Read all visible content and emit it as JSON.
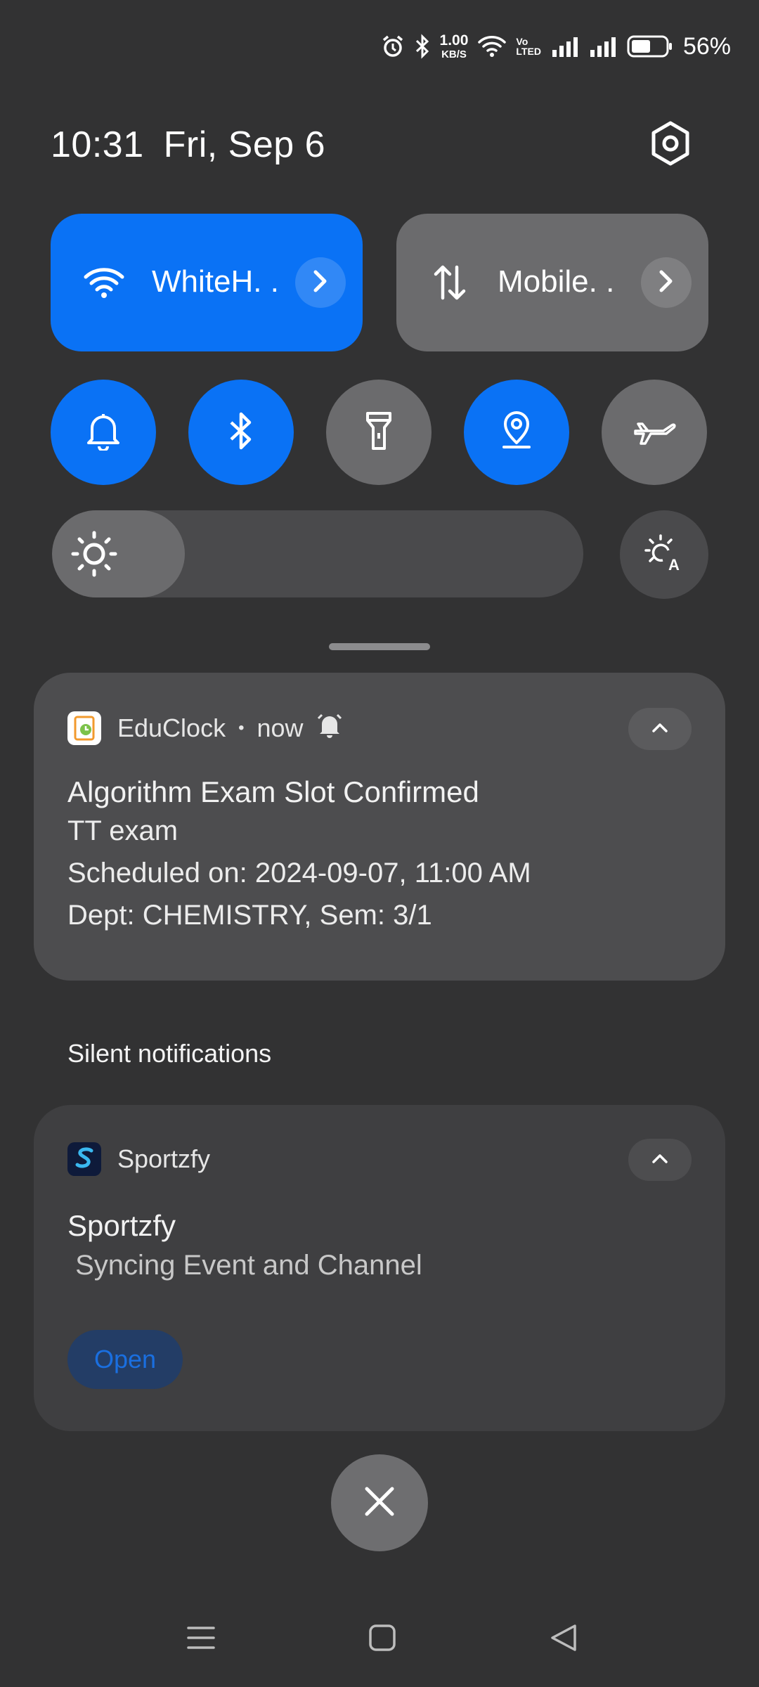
{
  "status_bar": {
    "net_speed_value": "1.00",
    "net_speed_unit": "KB/S",
    "volte_top": "Vo",
    "volte_bottom": "LTED",
    "battery_percent": "56%",
    "battery_level": 0.56,
    "icons": [
      "alarm-icon",
      "bluetooth-icon",
      "wifi-icon",
      "signal-icon",
      "signal-icon",
      "battery-icon"
    ]
  },
  "header": {
    "time": "10:31",
    "date": "Fri, Sep 6",
    "settings_icon": "settings-icon"
  },
  "quick_settings": {
    "wifi_tile": {
      "label": "WhiteH. .",
      "state": "on"
    },
    "mobile_tile": {
      "label": "Mobile. .",
      "state": "off"
    },
    "toggles": [
      {
        "name": "sound",
        "icon": "bell-icon",
        "state": "on"
      },
      {
        "name": "bluetooth",
        "icon": "bluetooth-icon",
        "state": "on"
      },
      {
        "name": "flashlight",
        "icon": "flashlight-icon",
        "state": "off"
      },
      {
        "name": "location",
        "icon": "location-icon",
        "state": "on"
      },
      {
        "name": "airplane",
        "icon": "airplane-icon",
        "state": "off"
      }
    ],
    "brightness_level": 0.25,
    "auto_brightness_icon": "auto-brightness-icon"
  },
  "notifications": {
    "educlock": {
      "app_name": "EduClock",
      "separator": "•",
      "time": "now",
      "title": "Algorithm Exam Slot Confirmed",
      "lines": [
        "TT exam",
        "Scheduled on: 2024-09-07, 11:00 AM",
        "Dept: CHEMISTRY, Sem:  3/1"
      ]
    },
    "silent_header": "Silent notifications",
    "sportzfy": {
      "app_name": "Sportzfy",
      "title": "Sportzfy",
      "body": " Syncing Event and Channel",
      "action": "Open"
    }
  },
  "colors": {
    "accent": "#0a72f5",
    "background": "#323233",
    "card": "#4d4d4f",
    "tile_off": "#6b6b6d"
  }
}
